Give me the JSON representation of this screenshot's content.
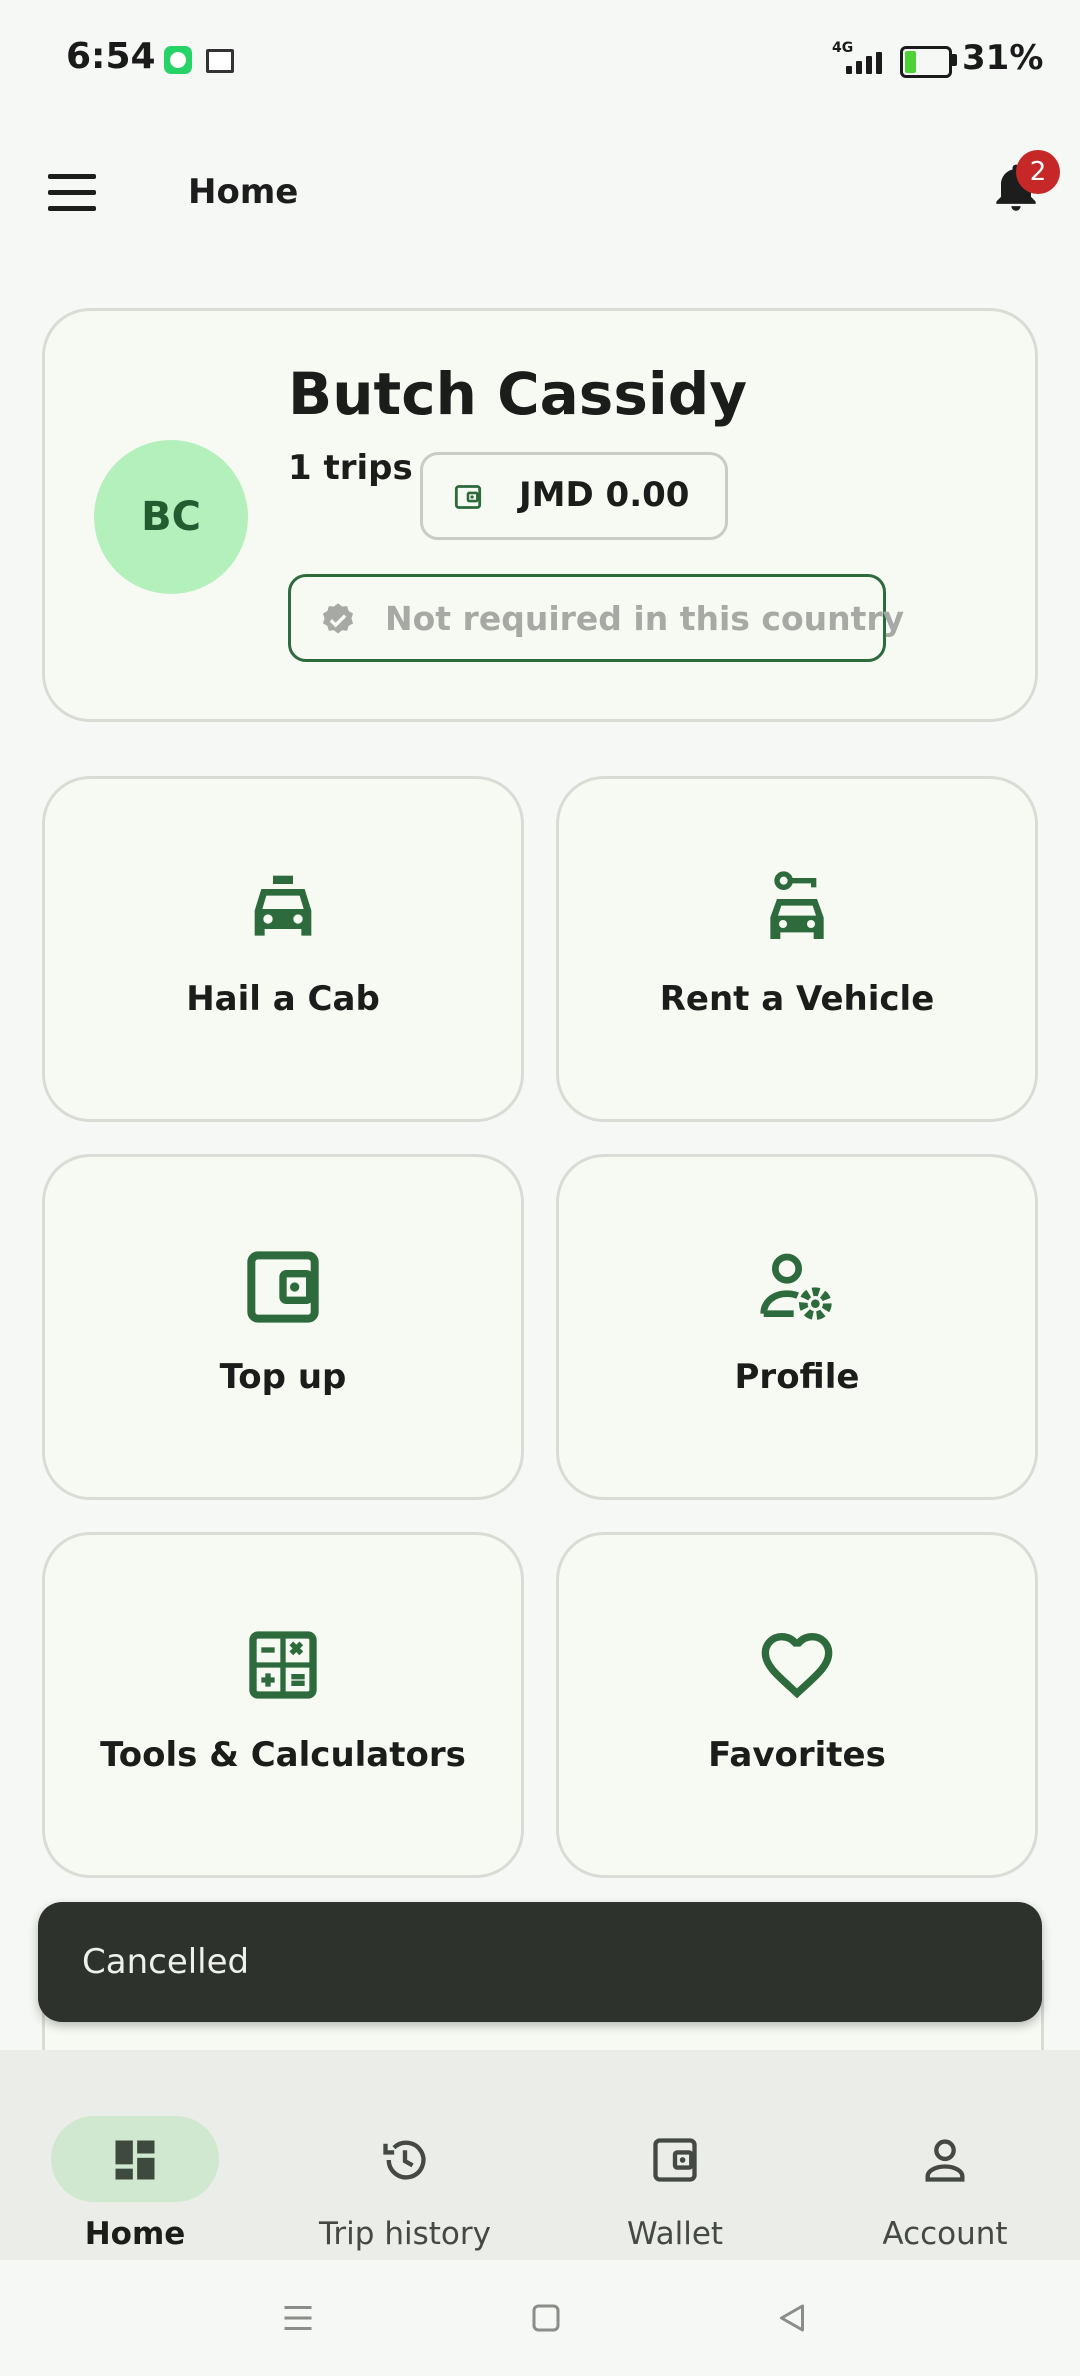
{
  "status_bar": {
    "time": "6:54",
    "network": "4G",
    "battery": "31%",
    "battery_level": 0.31
  },
  "app_bar": {
    "title": "Home",
    "notification_count": "2"
  },
  "profile": {
    "initials": "BC",
    "name": "Butch Cassidy",
    "trips": "1 trips",
    "wallet_balance": "JMD 0.00",
    "verification": "Not required in this country"
  },
  "tiles": [
    {
      "label": "Hail a Cab",
      "icon": "taxi-icon"
    },
    {
      "label": "Rent a Vehicle",
      "icon": "car-key-icon"
    },
    {
      "label": "Top up",
      "icon": "wallet-icon"
    },
    {
      "label": "Profile",
      "icon": "person-settings-icon"
    },
    {
      "label": "Tools & Calculators",
      "icon": "calculator-icon"
    },
    {
      "label": "Favorites",
      "icon": "heart-icon"
    }
  ],
  "snackbar": {
    "message": "Cancelled"
  },
  "bottom_nav": [
    {
      "label": "Home",
      "icon": "dashboard-icon",
      "active": true
    },
    {
      "label": "Trip history",
      "icon": "history-icon",
      "active": false
    },
    {
      "label": "Wallet",
      "icon": "wallet-icon",
      "active": false
    },
    {
      "label": "Account",
      "icon": "person-icon",
      "active": false
    }
  ],
  "colors": {
    "accent": "#2e6b3c",
    "avatar_bg": "#b4f0bc",
    "badge": "#c62828",
    "snackbar_bg": "#2e322d"
  }
}
